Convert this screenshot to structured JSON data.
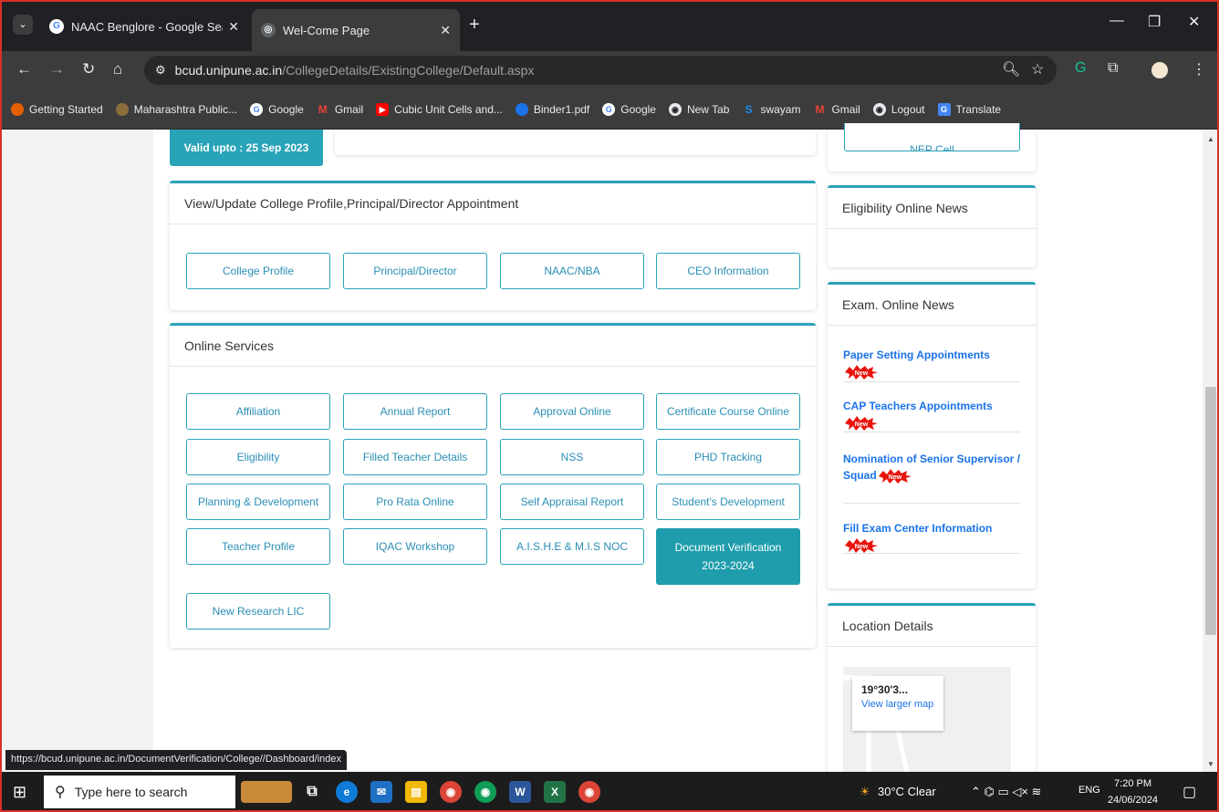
{
  "browser": {
    "tabs": [
      {
        "title": "NAAC Benglore - Google Searc",
        "icon": "google-icon",
        "active": false
      },
      {
        "title": "Wel-Come Page",
        "icon": "globe-icon",
        "active": true
      }
    ],
    "url_host": "bcud.unipune.ac.in",
    "url_path": "/CollegeDetails/ExistingCollege/Default.aspx",
    "bookmarks": [
      {
        "label": "Getting Started",
        "icon": "firefox-icon",
        "color": "#e66000"
      },
      {
        "label": "Maharashtra Public...",
        "icon": "emblem-icon",
        "color": "#8a6d3b"
      },
      {
        "label": "Google",
        "icon": "google-icon",
        "color": "#4285f4"
      },
      {
        "label": "Gmail",
        "icon": "gmail-icon",
        "color": "#ea4335"
      },
      {
        "label": "Cubic Unit Cells and...",
        "icon": "youtube-icon",
        "color": "#ff0000"
      },
      {
        "label": "Binder1.pdf",
        "icon": "globe-icon",
        "color": "#1a73e8"
      },
      {
        "label": "Google",
        "icon": "google-icon",
        "color": "#4285f4"
      },
      {
        "label": "New Tab",
        "icon": "globe-icon",
        "color": "#5f6368"
      },
      {
        "label": "swayam",
        "icon": "swayam-icon",
        "color": "#1e88e5"
      },
      {
        "label": "Gmail",
        "icon": "gmail-icon",
        "color": "#ea4335"
      },
      {
        "label": "Logout",
        "icon": "globe-icon",
        "color": "#5f6368"
      },
      {
        "label": "Translate",
        "icon": "translate-icon",
        "color": "#4285f4"
      }
    ],
    "status_url": "https://bcud.unipune.ac.in/DocumentVerification/College//Dashboard/index"
  },
  "page": {
    "valid_upto": "Valid upto : 25 Sep 2023",
    "profile_card": {
      "title": "View/Update College Profile,Principal/Director Appointment",
      "buttons": [
        "College Profile",
        "Principal/Director",
        "NAAC/NBA",
        "CEO Information"
      ]
    },
    "services_card": {
      "title": "Online Services",
      "buttons": [
        "Affiliation",
        "Annual Report",
        "Approval Online",
        "Certificate Course Online",
        "Eligibility",
        "Filled Teacher Details",
        "NSS",
        "PHD Tracking",
        "Planning & Development",
        "Pro Rata Online",
        "Self Appraisal Report",
        "Student's Development",
        "Teacher Profile",
        "IQAC Workshop",
        "A.I.S.H.E & M.I.S NOC"
      ],
      "doc_verification": [
        "Document Verification",
        "2023-2024"
      ],
      "research": "New Research LIC"
    },
    "nep_cell": "NEP Cell",
    "eligibility_news": {
      "title": "Eligibility Online News"
    },
    "exam_news": {
      "title": "Exam. Online News",
      "items": [
        "Paper Setting Appointments",
        "CAP Teachers Appointments",
        "Nomination of Senior Supervisor / Squad",
        "Fill Exam Center Information"
      ],
      "new_badge": "New"
    },
    "location": {
      "title": "Location Details",
      "coord": "19°30'3...",
      "link": "View larger map"
    }
  },
  "taskbar": {
    "search_placeholder": "Type here to search",
    "weather": "30°C  Clear",
    "lang": "ENG",
    "time": "7:20 PM",
    "date": "24/06/2024"
  },
  "colors": {
    "accent": "#29a3b8",
    "link": "#1a73e8"
  }
}
